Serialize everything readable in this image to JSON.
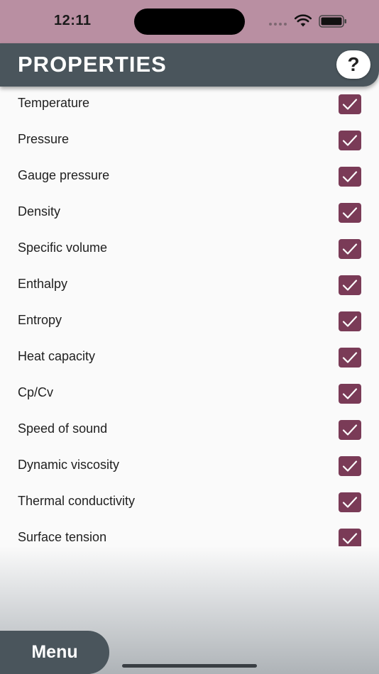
{
  "status_bar": {
    "time": "12:11"
  },
  "header": {
    "title": "PROPERTIES",
    "help_label": "?"
  },
  "properties": [
    {
      "label": "Temperature",
      "checked": true
    },
    {
      "label": "Pressure",
      "checked": true
    },
    {
      "label": "Gauge pressure",
      "checked": true
    },
    {
      "label": "Density",
      "checked": true
    },
    {
      "label": "Specific volume",
      "checked": true
    },
    {
      "label": "Enthalpy",
      "checked": true
    },
    {
      "label": "Entropy",
      "checked": true
    },
    {
      "label": "Heat capacity",
      "checked": true
    },
    {
      "label": "Cp/Cv",
      "checked": true
    },
    {
      "label": "Speed of sound",
      "checked": true
    },
    {
      "label": "Dynamic viscosity",
      "checked": true
    },
    {
      "label": "Thermal conductivity",
      "checked": true
    },
    {
      "label": "Surface tension",
      "checked": true
    }
  ],
  "footer": {
    "menu_label": "Menu"
  },
  "colors": {
    "accent": "#7a3b57",
    "header": "#4a555c",
    "status_bar": "#b98fa2"
  },
  "icons": {
    "checkbox": "checkmark-icon",
    "help": "question-mark-icon"
  }
}
